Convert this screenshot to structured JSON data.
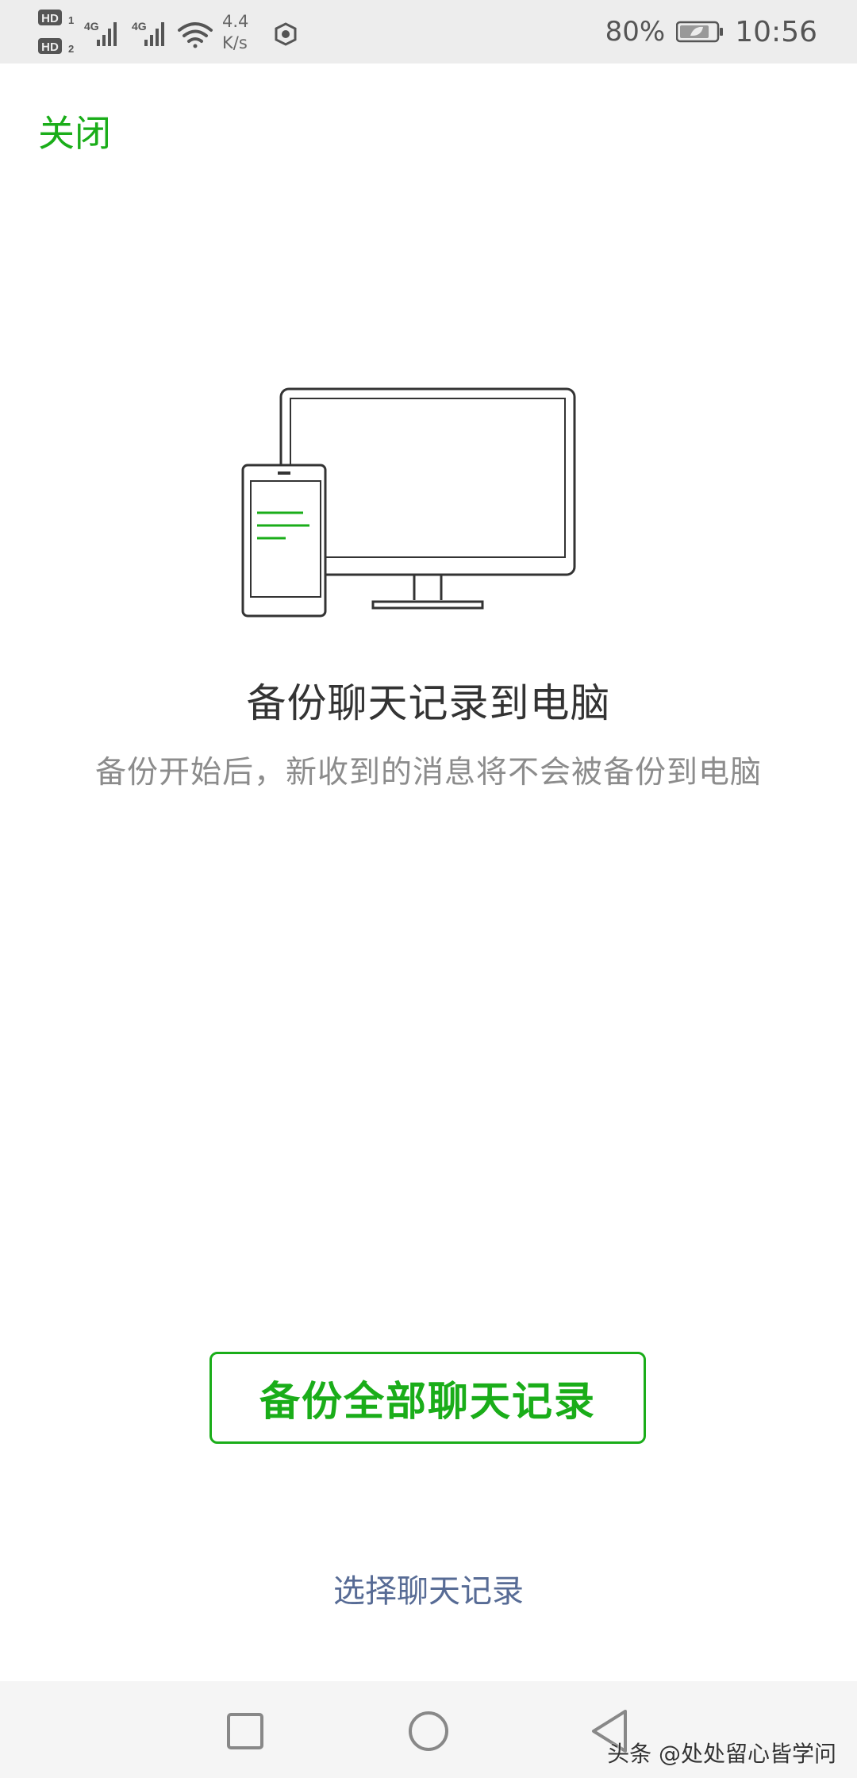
{
  "status_bar": {
    "sim1_badge": "HD",
    "sim1_index": "1",
    "sim2_badge": "HD",
    "sim2_index": "2",
    "network1": "4G",
    "network2": "4G",
    "net_speed_value": "4.4",
    "net_speed_unit": "K/s",
    "battery_percent": "80%",
    "time": "10:56",
    "icons": [
      "signal-icon",
      "wifi-icon",
      "app-notification-icon",
      "battery-icon"
    ]
  },
  "header": {
    "close_label": "关闭"
  },
  "content": {
    "title": "备份聊天记录到电脑",
    "subtitle": "备份开始后，新收到的消息将不会被备份到电脑"
  },
  "actions": {
    "backup_all_label": "备份全部聊天记录",
    "select_label": "选择聊天记录"
  },
  "nav_bar": {
    "icons": [
      "recents-square-icon",
      "home-circle-icon",
      "back-triangle-icon"
    ]
  },
  "watermark": "头条 @处处留心皆学问",
  "colors": {
    "accent": "#1aad19",
    "link": "#576b95",
    "title": "#333333",
    "subtitle": "#8c8c8c"
  }
}
